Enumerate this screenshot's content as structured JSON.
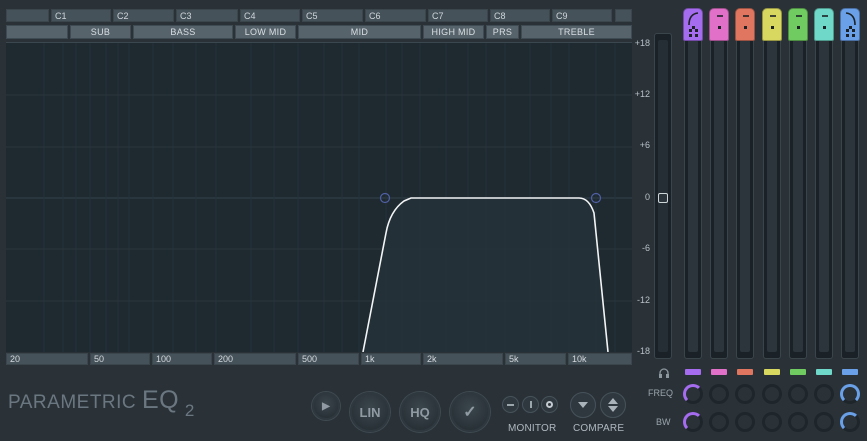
{
  "notes": [
    "",
    "C1",
    "C2",
    "C3",
    "C4",
    "C5",
    "C6",
    "C7",
    "C8",
    "C9",
    ""
  ],
  "bands": [
    "",
    "SUB",
    "BASS",
    "LOW MID",
    "MID",
    "HIGH MID",
    "PRS",
    "TREBLE"
  ],
  "db_scale": [
    "+18",
    "+12",
    "+6",
    "0",
    "-6",
    "-12",
    "-18"
  ],
  "freq_scale": [
    "20",
    "50",
    "100",
    "200",
    "500",
    "1k",
    "2k",
    "5k",
    "10k"
  ],
  "logo": {
    "text": "PARAMETRIC",
    "eq": "EQ",
    "version": "2"
  },
  "buttons": {
    "lin": "LIN",
    "hq": "HQ",
    "check": "✓",
    "play": "▶"
  },
  "monitor_label": "MONITOR",
  "compare_label": "COMPARE",
  "right_labels": {
    "freq": "FREQ",
    "bw": "BW"
  },
  "band_colors": [
    "#a66cf0",
    "#e070c8",
    "#e0765f",
    "#d8d860",
    "#70cc60",
    "#70d8c8",
    "#6aa0e8"
  ],
  "icons": {
    "headphones": "headphones-icon"
  }
}
